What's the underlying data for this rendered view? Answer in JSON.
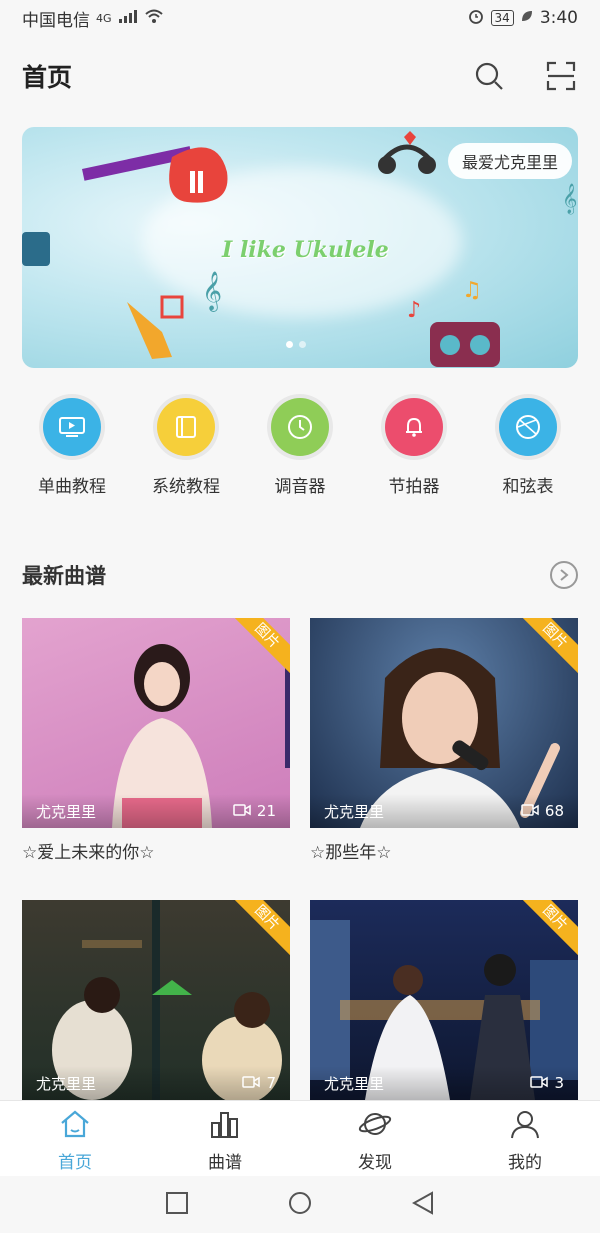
{
  "status_bar": {
    "carrier": "中国电信",
    "network": "4G",
    "battery": "34",
    "time": "3:40"
  },
  "header": {
    "title": "首页",
    "search_icon": "search-icon",
    "scan_icon": "scan-icon"
  },
  "banner": {
    "tagline": "I like Ukulele",
    "pill_label": "最爱尤克里里",
    "active_dot": 1,
    "dot_count": 2
  },
  "quick_actions": [
    {
      "label": "单曲教程",
      "icon": "tv-icon",
      "color": "#3bb3e6"
    },
    {
      "label": "系统教程",
      "icon": "book-icon",
      "color": "#f6cf3a"
    },
    {
      "label": "调音器",
      "icon": "clock-icon",
      "color": "#8fcd57"
    },
    {
      "label": "节拍器",
      "icon": "bell-icon",
      "color": "#ec4d6d"
    },
    {
      "label": "和弦表",
      "icon": "ball-icon",
      "color": "#3bb3e6"
    }
  ],
  "section": {
    "title": "最新曲谱",
    "more_icon": "chevron-right-icon"
  },
  "cards": [
    {
      "corner": "图片",
      "author": "尤克里里",
      "count": "21",
      "caption": "☆爱上未来的你☆",
      "bg": "#d58fc4"
    },
    {
      "corner": "图片",
      "author": "尤克里里",
      "count": "68",
      "caption": "☆那些年☆",
      "bg": "#203a5c"
    },
    {
      "corner": "图片",
      "author": "尤克里里",
      "count": "7",
      "caption": "",
      "bg": "#2e3a36"
    },
    {
      "corner": "图片",
      "author": "尤克里里",
      "count": "3",
      "caption": "",
      "bg": "#1b2a54"
    }
  ],
  "tabs": [
    {
      "label": "首页",
      "icon": "home-icon",
      "active": true
    },
    {
      "label": "曲谱",
      "icon": "bar-chart-icon",
      "active": false
    },
    {
      "label": "发现",
      "icon": "planet-icon",
      "active": false
    },
    {
      "label": "我的",
      "icon": "person-icon",
      "active": false
    }
  ],
  "colors": {
    "accent": "#49a7d8",
    "corner_badge": "#f5b21e"
  }
}
